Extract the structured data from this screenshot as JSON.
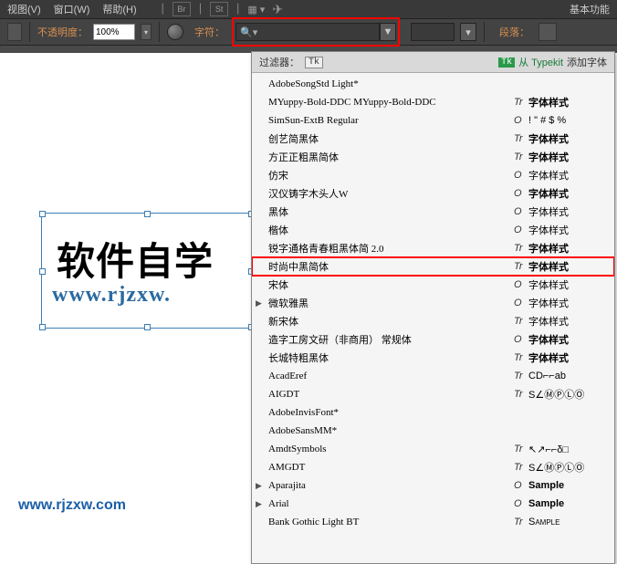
{
  "menubar": {
    "view": "视图(V)",
    "window": "窗口(W)",
    "help": "帮助(H)",
    "icon_br": "Br",
    "icon_st": "St",
    "basic_func": "基本功能"
  },
  "optbar": {
    "opacity_label": "不透明度：",
    "opacity_value": "100%",
    "char_label": "字符：",
    "search_icon": "🔍▾",
    "seg_label": "段落："
  },
  "filter": {
    "label": "过滤器：",
    "tk": "Tk",
    "from": "从 Typekit",
    "add": "添加字体"
  },
  "canvas": {
    "big_text": "软件自学",
    "url_text": "www.rjzxw.",
    "watermark": "www.rjzxw.com"
  },
  "fonts": [
    {
      "name": "AdobeSongStd Light*",
      "ico": "",
      "sample": "",
      "arrow": false
    },
    {
      "name": "MYuppy-Bold-DDC MYuppy-Bold-DDC",
      "ico": "Tr",
      "sample": "字体样式",
      "arrow": false,
      "bold": true
    },
    {
      "name": "SimSun-ExtB Regular",
      "ico": "O",
      "sample": "! \" # $ %",
      "arrow": false
    },
    {
      "name": "创艺简黑体",
      "ico": "Tr",
      "sample": "字体样式",
      "arrow": false,
      "bold": true
    },
    {
      "name": "方正正粗黑简体",
      "ico": "Tr",
      "sample": "字体样式",
      "arrow": false,
      "bold": true
    },
    {
      "name": "仿宋",
      "ico": "O",
      "sample": "字体样式",
      "arrow": false
    },
    {
      "name": "汉仪铸字木头人W",
      "ico": "O",
      "sample": "字体样式",
      "arrow": false,
      "bold": true
    },
    {
      "name": "黑体",
      "ico": "O",
      "sample": "字体样式",
      "arrow": false
    },
    {
      "name": "楷体",
      "ico": "O",
      "sample": "字体样式",
      "arrow": false
    },
    {
      "name": "锐字通格青春粗黑体简 2.0",
      "ico": "Tr",
      "sample": "字体样式",
      "arrow": false,
      "bold": true
    },
    {
      "name": "时尚中黑简体",
      "ico": "Tr",
      "sample": "字体样式",
      "arrow": false,
      "hl": true,
      "bold": true
    },
    {
      "name": "宋体",
      "ico": "O",
      "sample": "字体样式",
      "arrow": false
    },
    {
      "name": "微软雅黑",
      "ico": "O",
      "sample": "字体样式",
      "arrow": true
    },
    {
      "name": "新宋体",
      "ico": "Tr",
      "sample": "字体样式",
      "arrow": false
    },
    {
      "name": "造字工房文研（非商用） 常规体",
      "ico": "O",
      "sample": "字体样式",
      "arrow": false,
      "bold": true
    },
    {
      "name": "长城特粗黑体",
      "ico": "Tr",
      "sample": "字体样式",
      "arrow": false,
      "bold": true
    },
    {
      "name": "AcadEref",
      "ico": "Tr",
      "sample": "CD⌐⌐ab",
      "arrow": false
    },
    {
      "name": "AIGDT",
      "ico": "Tr",
      "sample": "S∠ⓂⓅⓁⓄ",
      "arrow": false
    },
    {
      "name": "AdobeInvisFont*",
      "ico": "",
      "sample": "",
      "arrow": false
    },
    {
      "name": "AdobeSansMM*",
      "ico": "",
      "sample": "",
      "arrow": false
    },
    {
      "name": "AmdtSymbols",
      "ico": "Tr",
      "sample": "↖↗⌐⌐δ□",
      "arrow": false
    },
    {
      "name": "AMGDT",
      "ico": "Tr",
      "sample": "S∠ⓂⓅⓁⓄ",
      "arrow": false
    },
    {
      "name": "Aparajita",
      "ico": "O",
      "sample": "Sample",
      "arrow": true,
      "bold": true
    },
    {
      "name": "Arial",
      "ico": "O",
      "sample": "Sample",
      "arrow": true,
      "bold": true
    },
    {
      "name": "Bank Gothic Light BT",
      "ico": "Tr",
      "sample": "Sample",
      "arrow": false,
      "sc": true
    }
  ]
}
